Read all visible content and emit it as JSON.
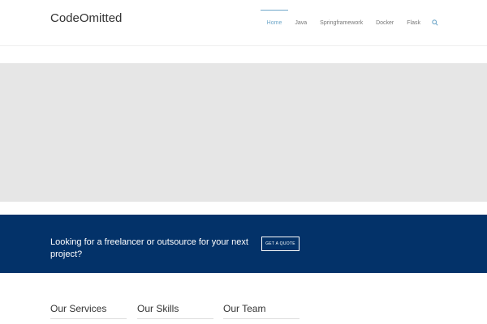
{
  "header": {
    "logo": "CodeOmitted",
    "nav": [
      {
        "label": "Home",
        "active": true
      },
      {
        "label": "Java",
        "active": false
      },
      {
        "label": "Springframework",
        "active": false
      },
      {
        "label": "Docker",
        "active": false
      },
      {
        "label": "Flask",
        "active": false
      }
    ],
    "search_icon": "search-icon"
  },
  "cta": {
    "text": "Looking for a freelancer or outsource for your next project?",
    "button_label": "GET A QUOTE"
  },
  "sections": [
    {
      "title": "Our Services"
    },
    {
      "title": "Our Skills"
    },
    {
      "title": "Our Team"
    }
  ],
  "colors": {
    "accent": "#6fa7c9",
    "cta_background": "#033269",
    "hero_background": "#e6e6e6"
  }
}
